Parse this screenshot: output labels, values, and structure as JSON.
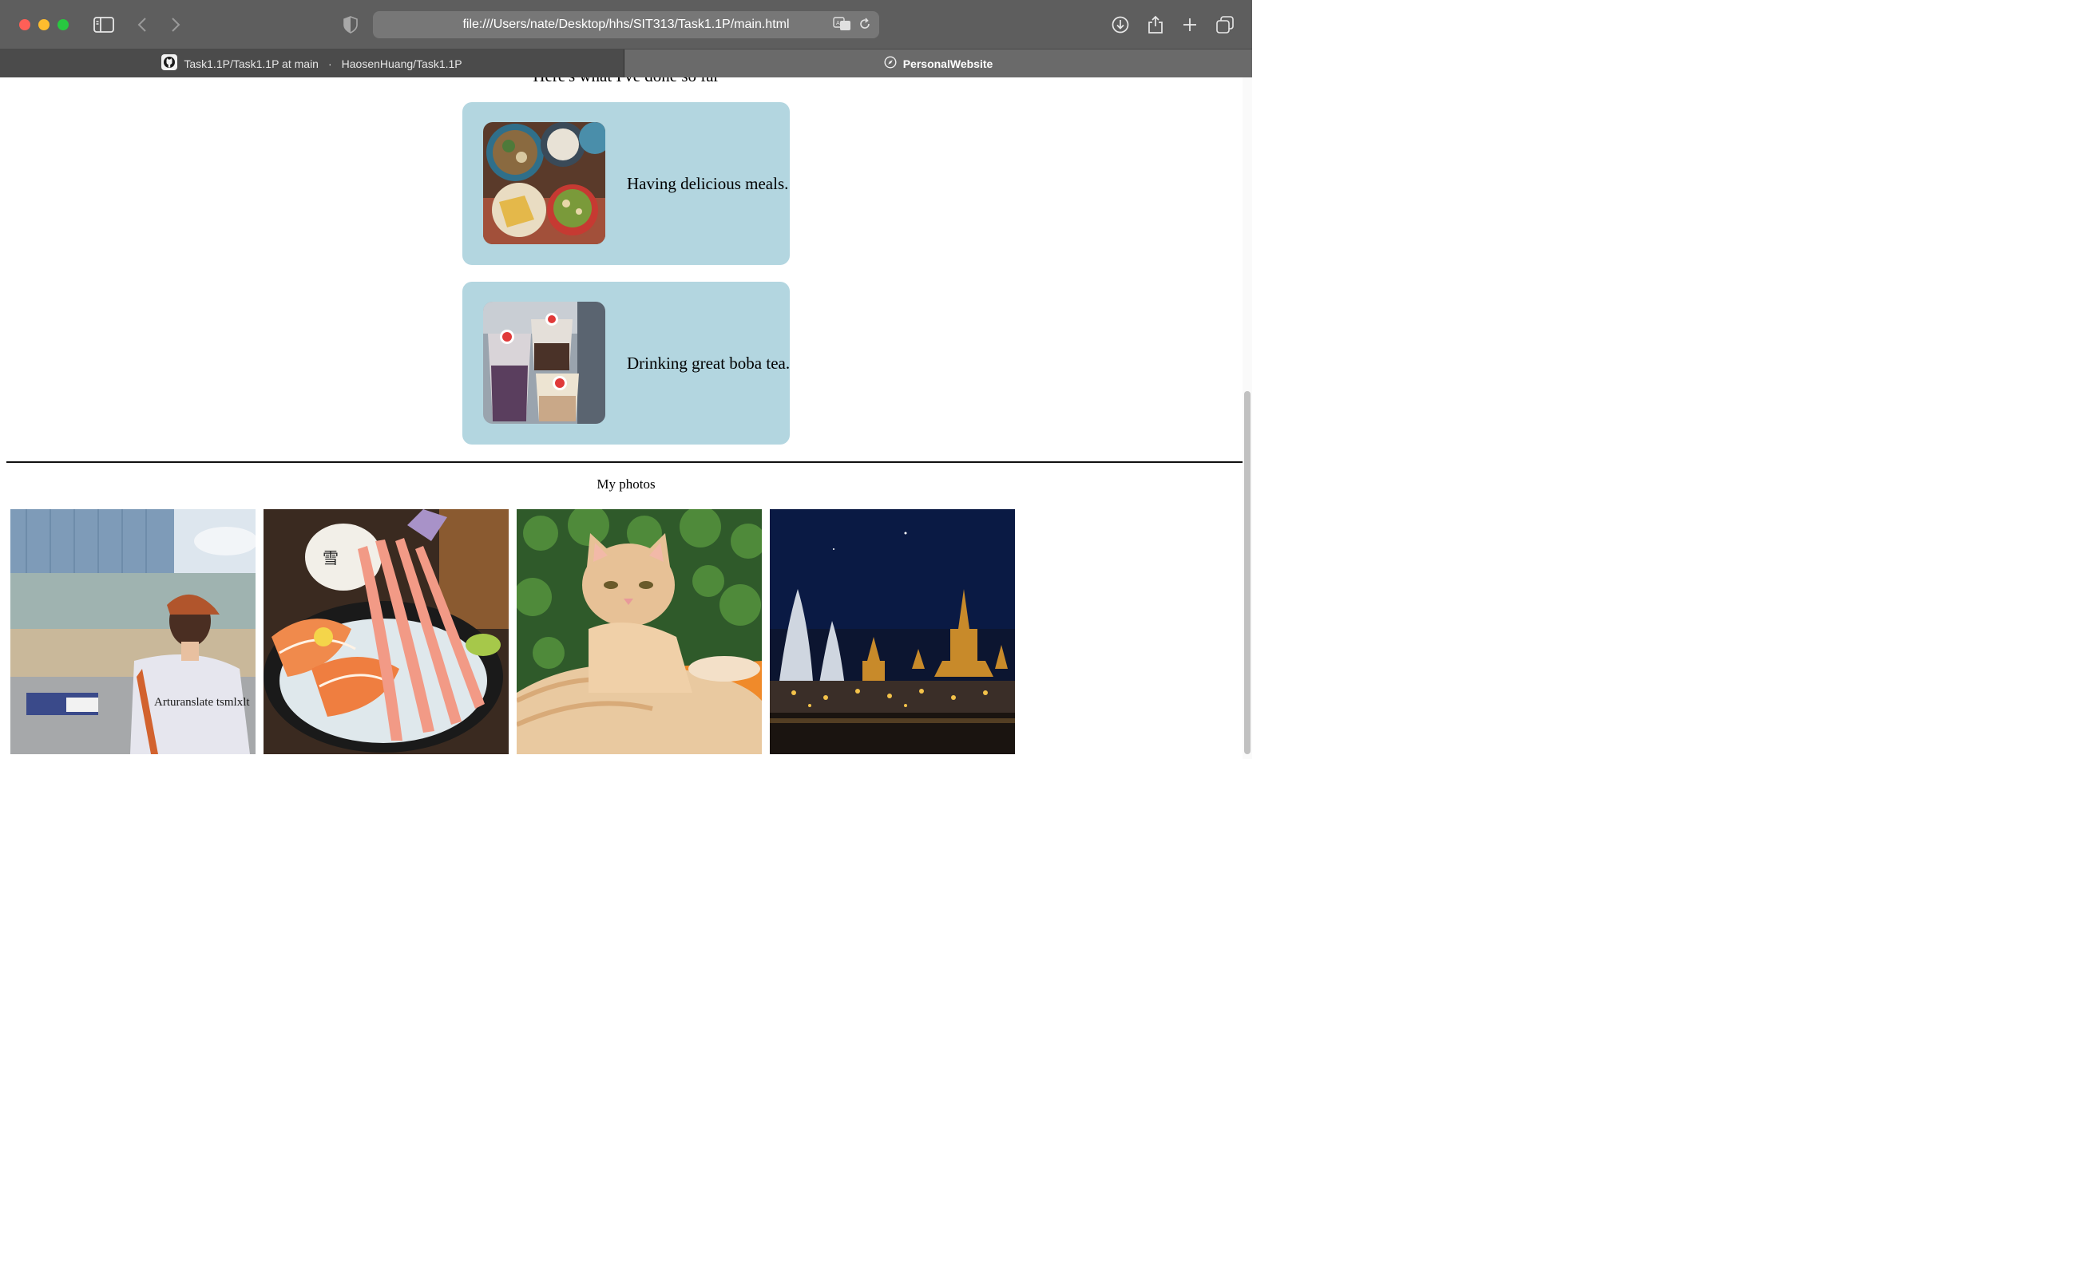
{
  "browser": {
    "url": "file:///Users/nate/Desktop/hhs/SIT313/Task1.1P/main.html",
    "tabs": [
      {
        "title_left": "Task1.1P/Task1.1P at main",
        "title_right": "HaosenHuang/Task1.1P",
        "icon": "github-icon"
      },
      {
        "title": "PersonalWebsite",
        "icon": "compass-icon"
      }
    ]
  },
  "page": {
    "intro_heading": "Here's what I've done so far",
    "activities": [
      {
        "caption": "Having delicious meals."
      },
      {
        "caption": "Drinking great boba tea."
      }
    ],
    "photos_title": "My photos",
    "photos": [
      {
        "subject": "street-portrait"
      },
      {
        "subject": "sashimi-platter"
      },
      {
        "subject": "orange-cat"
      },
      {
        "subject": "night-temple"
      }
    ],
    "shirt_text": "Arturanslate tsmlxlt"
  },
  "colors": {
    "card_bg": "#b3d6e0",
    "toolbar_bg": "#5e5e5e"
  }
}
